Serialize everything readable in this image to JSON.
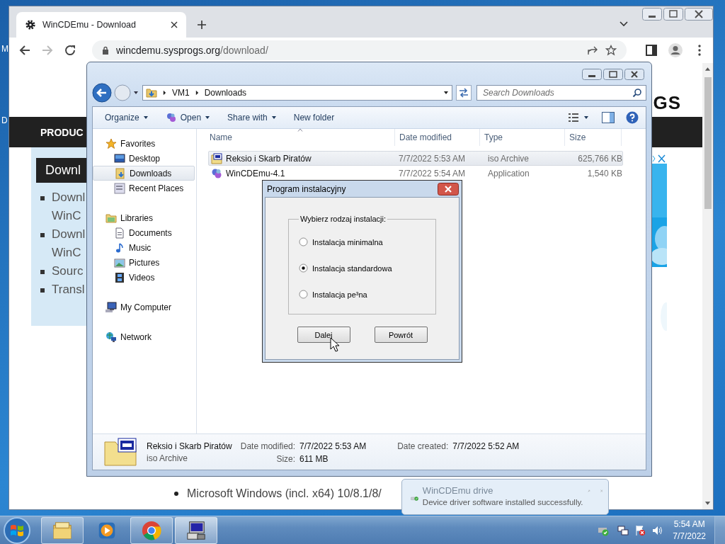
{
  "desktop_labels": [
    "M",
    "D"
  ],
  "browser": {
    "tab": {
      "title": "WinCDEmu - Download",
      "selected": true
    },
    "url_host": "wincdemu.sysprogs.org",
    "url_path": "/download/",
    "page": {
      "logo": "GS",
      "nav_item": "PRODUC",
      "panel_title": "Downl",
      "panel_items": [
        {
          "lines": [
            "Downl",
            "WinC"
          ]
        },
        {
          "lines": [
            "Downl",
            "WinC"
          ]
        },
        {
          "lines": [
            "Sourc"
          ]
        },
        {
          "lines": [
            "Transl"
          ]
        }
      ],
      "bullet": "Microsoft Windows (incl. x64) 10/8.1/8/"
    }
  },
  "explorer": {
    "path": [
      "VM1",
      "Downloads"
    ],
    "search_placeholder": "Search Downloads",
    "commands": [
      {
        "label": "Organize",
        "kind": "plain",
        "dropdown": true
      },
      {
        "label": "Open",
        "kind": "open",
        "dropdown": true
      },
      {
        "label": "Share with",
        "kind": "plain",
        "dropdown": true
      },
      {
        "label": "New folder",
        "kind": "plain",
        "dropdown": false
      }
    ],
    "nav": [
      {
        "label": "Favorites",
        "kind": "star",
        "children": [
          {
            "label": "Desktop",
            "kind": "desktop",
            "selected": false
          },
          {
            "label": "Downloads",
            "kind": "downloads",
            "selected": true
          },
          {
            "label": "Recent Places",
            "kind": "recent",
            "selected": false
          }
        ]
      },
      {
        "label": "Libraries",
        "kind": "libraries",
        "children": [
          {
            "label": "Documents",
            "kind": "documents",
            "selected": false
          },
          {
            "label": "Music",
            "kind": "music",
            "selected": false
          },
          {
            "label": "Pictures",
            "kind": "pictures",
            "selected": false
          },
          {
            "label": "Videos",
            "kind": "videos",
            "selected": false
          }
        ]
      },
      {
        "label": "My Computer",
        "kind": "computer"
      },
      {
        "label": "Network",
        "kind": "network"
      }
    ],
    "columns": [
      "Name",
      "Date modified",
      "Type",
      "Size"
    ],
    "files": [
      {
        "name": "Reksio i Skarb Piratów",
        "date": "7/7/2022 5:53 AM",
        "type": "iso Archive",
        "size": "625,766 KB",
        "kind": "iso",
        "selected": true
      },
      {
        "name": "WinCDEmu-4.1",
        "date": "7/7/2022 5:54 AM",
        "type": "Application",
        "size": "1,540 KB",
        "kind": "app",
        "selected": false
      }
    ],
    "details": {
      "name": "Reksio i Skarb Piratów",
      "type": "iso Archive",
      "modified_label": "Date modified:",
      "modified": "7/7/2022 5:53 AM",
      "size_label": "Size:",
      "size": "611 MB",
      "created_label": "Date created:",
      "created": "7/7/2022 5:52 AM"
    }
  },
  "dialog": {
    "title": "Program instalacyjny",
    "group_label": "Wybierz rodzaj instalacji:",
    "options": [
      {
        "label": "Instalacja minimalna",
        "selected": false
      },
      {
        "label": "Instalacja standardowa",
        "selected": true
      },
      {
        "label": "Instalacja pe³na",
        "selected": false
      }
    ],
    "buttons": [
      "Dalej",
      "Powrót"
    ]
  },
  "notification": {
    "title": "WinCDEmu drive",
    "message": "Device driver software installed successfully."
  },
  "taskbar": {
    "apps": [
      {
        "kind": "explorer",
        "running": true,
        "selected": false
      },
      {
        "kind": "media",
        "running": false,
        "selected": false
      },
      {
        "kind": "chrome",
        "running": true,
        "selected": false
      },
      {
        "kind": "installer",
        "running": true,
        "selected": true
      }
    ],
    "time": "5:54 AM",
    "date": "7/7/2022"
  }
}
